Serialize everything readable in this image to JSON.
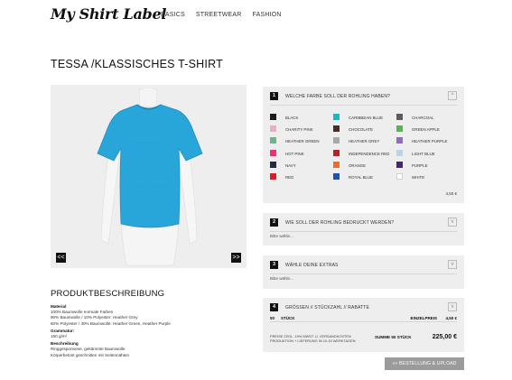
{
  "header": {
    "logo": "My Shirt Label",
    "nav": [
      "BASICS",
      "STREETWEAR",
      "FASHION"
    ]
  },
  "product": {
    "title": "TESSA /KLASSISCHES T-SHIRT",
    "prev": "<<",
    "next": ">>",
    "shirt_color": "#29a6d9"
  },
  "description": {
    "title": "PRODUKTBESCHREIBUNG",
    "material_label": "Material",
    "material_lines": [
      "100% Baumwolle normale Farben",
      "90% Baumwolle / 10% Polyester: Heather Grey",
      "60% Polyester / 40% Baumwolle: Heather Green, Heather Purple"
    ],
    "weight_label": "Grammatur:",
    "weight_value": "150 g/m²",
    "desc_label": "Beschreibung",
    "desc_lines": [
      "Ringgesponnene, gekämmte Baumwolle",
      "Körperbetont geschnitten mit Seitennähten"
    ]
  },
  "step1": {
    "number": "1",
    "title": "WELCHE FARBE SOLL DER ROHLING HABEN?",
    "toggle": "^",
    "colors": [
      {
        "name": "BLACK",
        "hex": "#1b1b1b"
      },
      {
        "name": "CARIBBEAN BLUE",
        "hex": "#1cb5c9"
      },
      {
        "name": "CHARCOAL",
        "hex": "#5c5c5e"
      },
      {
        "name": "CHARITY PINK",
        "hex": "#f4a9c3"
      },
      {
        "name": "CHOCOLATE",
        "hex": "#4b2c20"
      },
      {
        "name": "GREEN APPLE",
        "hex": "#4fba48"
      },
      {
        "name": "HEATHER GREEN",
        "hex": "#6fb38a"
      },
      {
        "name": "HEATHER GREY",
        "hex": "#a8a6a6"
      },
      {
        "name": "HEATHER PURPLE",
        "hex": "#8b6fb7"
      },
      {
        "name": "HOT PINK",
        "hex": "#e8327a"
      },
      {
        "name": "INDEPENDENCE RED",
        "hex": "#b1232d"
      },
      {
        "name": "LIGHT BLUE",
        "hex": "#b9d3ee"
      },
      {
        "name": "NAVY",
        "hex": "#1f2a44"
      },
      {
        "name": "ORANGE",
        "hex": "#f36b21"
      },
      {
        "name": "PURPLE",
        "hex": "#4a2478"
      },
      {
        "name": "RED",
        "hex": "#d71f27"
      },
      {
        "name": "ROYAL BLUE",
        "hex": "#1f53a8"
      },
      {
        "name": "WHITE",
        "hex": "#ffffff"
      }
    ],
    "price": "4,50 €"
  },
  "step2": {
    "number": "2",
    "title": "WIE SOLL DER ROHLING BEDRUCKT WERDEN?",
    "toggle": "v",
    "select": "Bitte wähle..."
  },
  "step3": {
    "number": "3",
    "title": "WÄHLE DEINE EXTRAS",
    "toggle": "v",
    "select": "Bitte wähle..."
  },
  "step4": {
    "number": "4",
    "title": "GRÖSSEN // STÜCKZAHL // RABATTE",
    "toggle": "v",
    "qty": "50",
    "qty_unit": "STÜCK",
    "unit_price_label": "EINZELPREIS",
    "unit_price": "4,50 €",
    "note": "PREISE ZZGL. 19% MWST. U. VERSANDKOSTEN PRODUKTION + LIEFERUNG IN 10-15 WERKTAGEN",
    "sum_label": "SUMME 50 STÜCK",
    "total": "225,00 €"
  },
  "order_button": "»» BESTELLUNG & UPLOAD"
}
